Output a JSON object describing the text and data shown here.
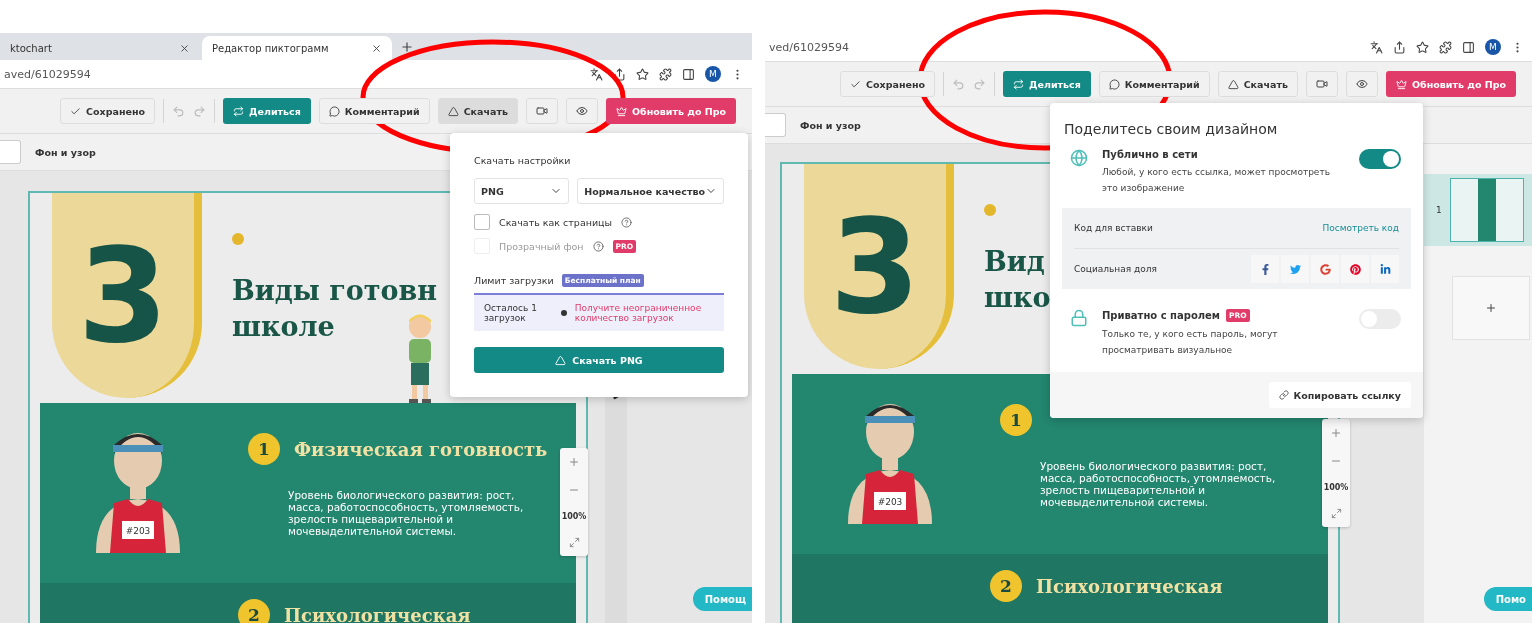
{
  "screens": [
    {
      "tabs": [
        {
          "label": "ktochart",
          "selected": false
        },
        {
          "label": "Редактор пиктограмм",
          "selected": true
        }
      ],
      "url": "aved/61029594",
      "avatar": "M",
      "toolbar": [
        {
          "kind": "status",
          "label": "Сохранено"
        },
        {
          "kind": "undo"
        },
        {
          "kind": "redo"
        },
        {
          "kind": "share",
          "label": "Делиться"
        },
        {
          "kind": "comment",
          "label": "Комментарий",
          "active": false
        },
        {
          "kind": "download",
          "label": "Скачать",
          "active": true
        },
        {
          "kind": "video",
          "active": false
        },
        {
          "kind": "preview",
          "active": false
        },
        {
          "kind": "upgrade",
          "label": "Обновить до Про"
        }
      ],
      "subbar": "Фон и узор",
      "infographic": {
        "number": "3",
        "title_lines": [
          "Виды готовн",
          "школе"
        ],
        "sections": [
          {
            "number": "1",
            "title": "Физическая готовность",
            "text": "Уровень биологического развития: рост, масса, работоспособность, утомляемость, зрелость пищеварительной и мочевыделительной системы.",
            "bib": "#203"
          },
          {
            "number": "2",
            "title": "Психологическая"
          }
        ]
      },
      "zoom_reading": "100%",
      "help": "Помощ",
      "popover": {
        "kind": "download",
        "heading": "Скачать настройки",
        "format": "PNG",
        "quality": "Нормальное качество",
        "options": [
          {
            "label": "Скачать как страницы",
            "checked": false,
            "disabled": false
          },
          {
            "label": "Прозрачный фон",
            "checked": false,
            "disabled": true,
            "badge": "PRO"
          }
        ],
        "limit": {
          "label": "Лимит загрузки",
          "badge": "Бесплатный план",
          "remaining": "Осталось 1 загрузок",
          "upsell": "Получите неограниченное количество загрузок"
        },
        "button": "Скачать PNG"
      }
    },
    {
      "url": "ved/61029594",
      "avatar": "M",
      "toolbar": [
        {
          "kind": "status",
          "label": "Сохранено"
        },
        {
          "kind": "undo"
        },
        {
          "kind": "redo"
        },
        {
          "kind": "share",
          "label": "Делиться"
        },
        {
          "kind": "comment",
          "label": "Комментарий",
          "active": false
        },
        {
          "kind": "download",
          "label": "Скачать",
          "active": false
        },
        {
          "kind": "video",
          "active": false
        },
        {
          "kind": "preview",
          "active": false
        },
        {
          "kind": "upgrade",
          "label": "Обновить до Про"
        }
      ],
      "subbar": "Фон и узор",
      "infographic": {
        "number": "3",
        "title_lines": [
          "Вид",
          "шко"
        ],
        "sections": [
          {
            "number": "1",
            "text": "Уровень биологического развития: рост, масса, работоспособность, утомляемость, зрелость пищеварительной и мочевыделительной системы.",
            "bib": "#203"
          },
          {
            "number": "2",
            "title": "Психологическая"
          }
        ]
      },
      "zoom_reading": "100%",
      "help": "Помо",
      "pages": [
        {
          "number": "1",
          "selected": true
        }
      ],
      "popover": {
        "kind": "share",
        "title": "Поделитесь своим дизайном",
        "public": {
          "title": "Публично в сети",
          "text": "Любой, у кого есть ссылка, может просмотреть это изображение",
          "on": true
        },
        "embed": {
          "label": "Код для вставки",
          "link": "Посмотреть код"
        },
        "social": {
          "label": "Социальная доля",
          "networks": [
            {
              "kind": "facebook"
            },
            {
              "kind": "twitter"
            },
            {
              "kind": "google"
            },
            {
              "kind": "pinterest"
            },
            {
              "kind": "linkedin"
            }
          ]
        },
        "private": {
          "title": "Приватно с паролем",
          "badge": "PRO",
          "text": "Только те, у кого есть пароль, могут просматривать визуальное",
          "on": false
        },
        "copy_button": "Копировать ссылку"
      }
    }
  ]
}
